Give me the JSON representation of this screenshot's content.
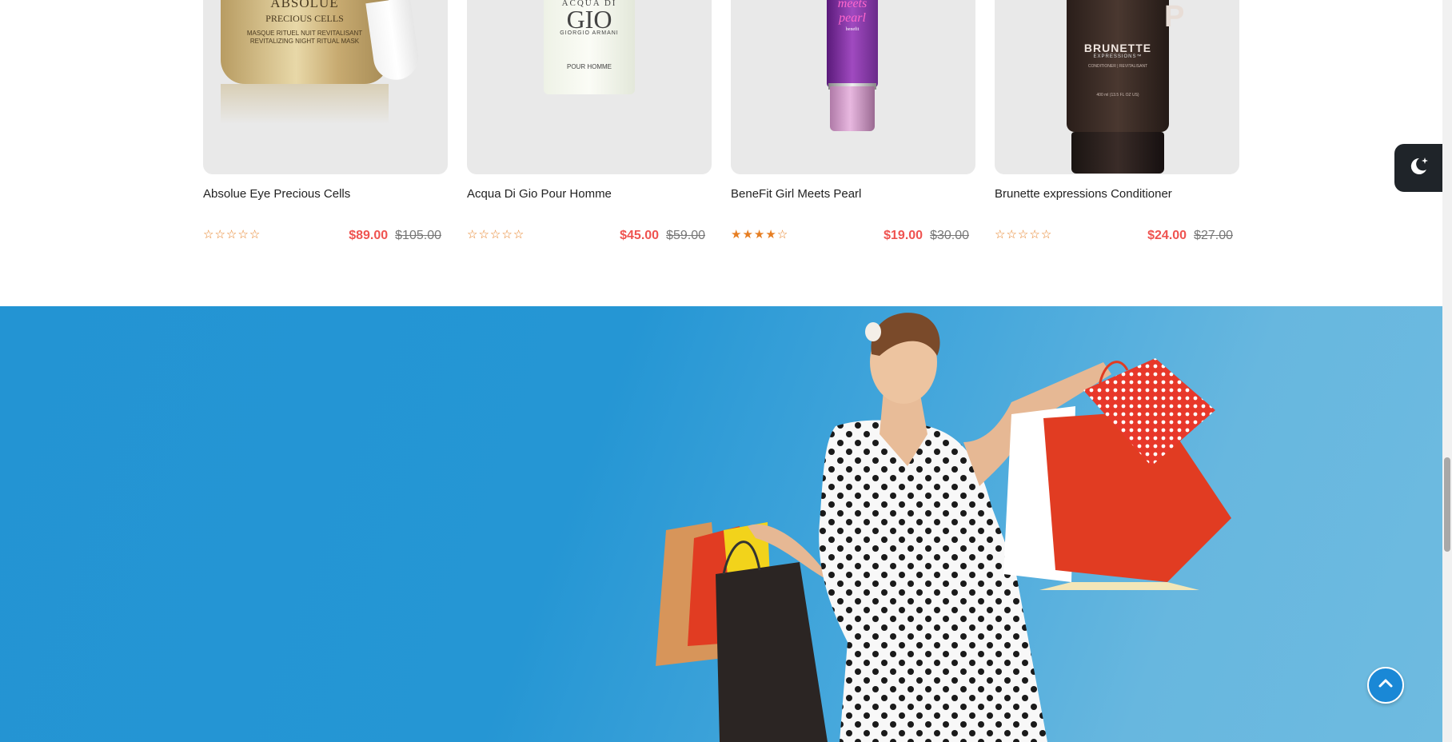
{
  "products": [
    {
      "name": "Absolue Eye Precious Cells",
      "rating": 0,
      "price": "$89.00",
      "old_price": "$105.00",
      "image": {
        "brand": "ABSOLUE",
        "line": "PRECIOUS CELLS",
        "text1": "MASQUE RITUEL NUIT REVITALISANT",
        "text2": "REVITALIZING NIGHT RITUAL MASK"
      }
    },
    {
      "name": "Acqua Di Gio Pour Homme",
      "rating": 0,
      "price": "$45.00",
      "old_price": "$59.00",
      "image": {
        "line1": "ACQUA DI",
        "line2": "GIO",
        "line3": "GIORGIO ARMANI",
        "line4": "POUR HOMME"
      }
    },
    {
      "name": "BeneFit Girl Meets Pearl",
      "rating": 4,
      "price": "$19.00",
      "old_price": "$30.00",
      "image": {
        "line1": "meets pearl",
        "line2": "benefit"
      }
    },
    {
      "name": "Brunette expressions Conditioner",
      "rating": 0,
      "price": "$24.00",
      "old_price": "$27.00",
      "image": {
        "brand": "BRUNETTE",
        "line": "EXPRESSIONS™",
        "text1": "CONDITIONER | REVITALISANT",
        "text2": "400 ml (13.5 FL OZ US)",
        "big": "P"
      }
    }
  ],
  "star_filled": "★",
  "star_empty": "☆",
  "colors": {
    "price": "#ef5350",
    "star": "#e67e22",
    "banner": "#2394d3",
    "to_top": "#1a88d6",
    "dark_toggle": "#1f2429"
  },
  "icons": {
    "dark_toggle": "moon-stars-icon",
    "to_top": "chevron-up-icon"
  }
}
